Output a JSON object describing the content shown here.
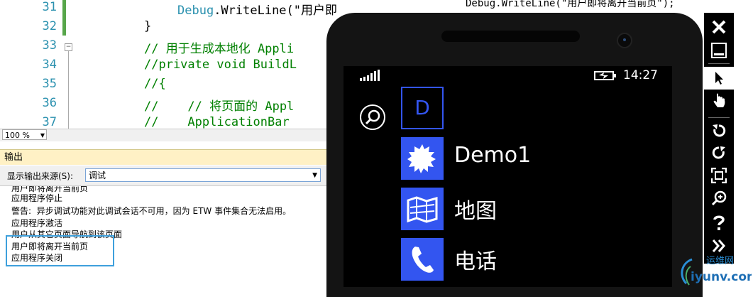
{
  "editor": {
    "lines": [
      {
        "num": "31",
        "code_debug": "Debug",
        "code_rest": ".WriteLine(\"用户即"
      },
      {
        "num": "32",
        "code": "}"
      },
      {
        "num": "33",
        "comment": "// 用于生成本地化 Appli"
      },
      {
        "num": "34",
        "comment": "//private void BuildL"
      },
      {
        "num": "35",
        "comment": "//{"
      },
      {
        "num": "36",
        "comment": "//    // 将页面的 Appl"
      },
      {
        "num": "37",
        "comment": "//    ApplicationBar "
      }
    ],
    "right_snippet": "Debug.WriteLine(\"用户即将离开当前页\");",
    "zoom": "100 %"
  },
  "output": {
    "title": "输出",
    "source_label": "显示输出来源(S):",
    "source_value": "调试",
    "lines": [
      "用户即将离开当前页",
      "应用程序停止",
      "警告:  异步调试功能对此调试会话不可用，因为 ETW 事件集合无法启用。",
      "应用程序激活",
      "用户从其它页面导航到该页面",
      "用户即将离开当前页",
      "应用程序关闭"
    ]
  },
  "phone": {
    "time": "14:27",
    "tiles": [
      {
        "letter": "D"
      },
      {
        "label": "Demo1",
        "icon": "gear-badge-icon"
      },
      {
        "label": "地图",
        "icon": "map-icon"
      },
      {
        "label": "电话",
        "icon": "phone-icon"
      }
    ]
  },
  "watermark": {
    "text_top": "运维网",
    "text_bottom": "iyunv.com"
  },
  "colors": {
    "accent": "#3355f0",
    "output_header": "#fff1c5",
    "highlight_box": "#3ea0dc",
    "comment": "#008000"
  }
}
